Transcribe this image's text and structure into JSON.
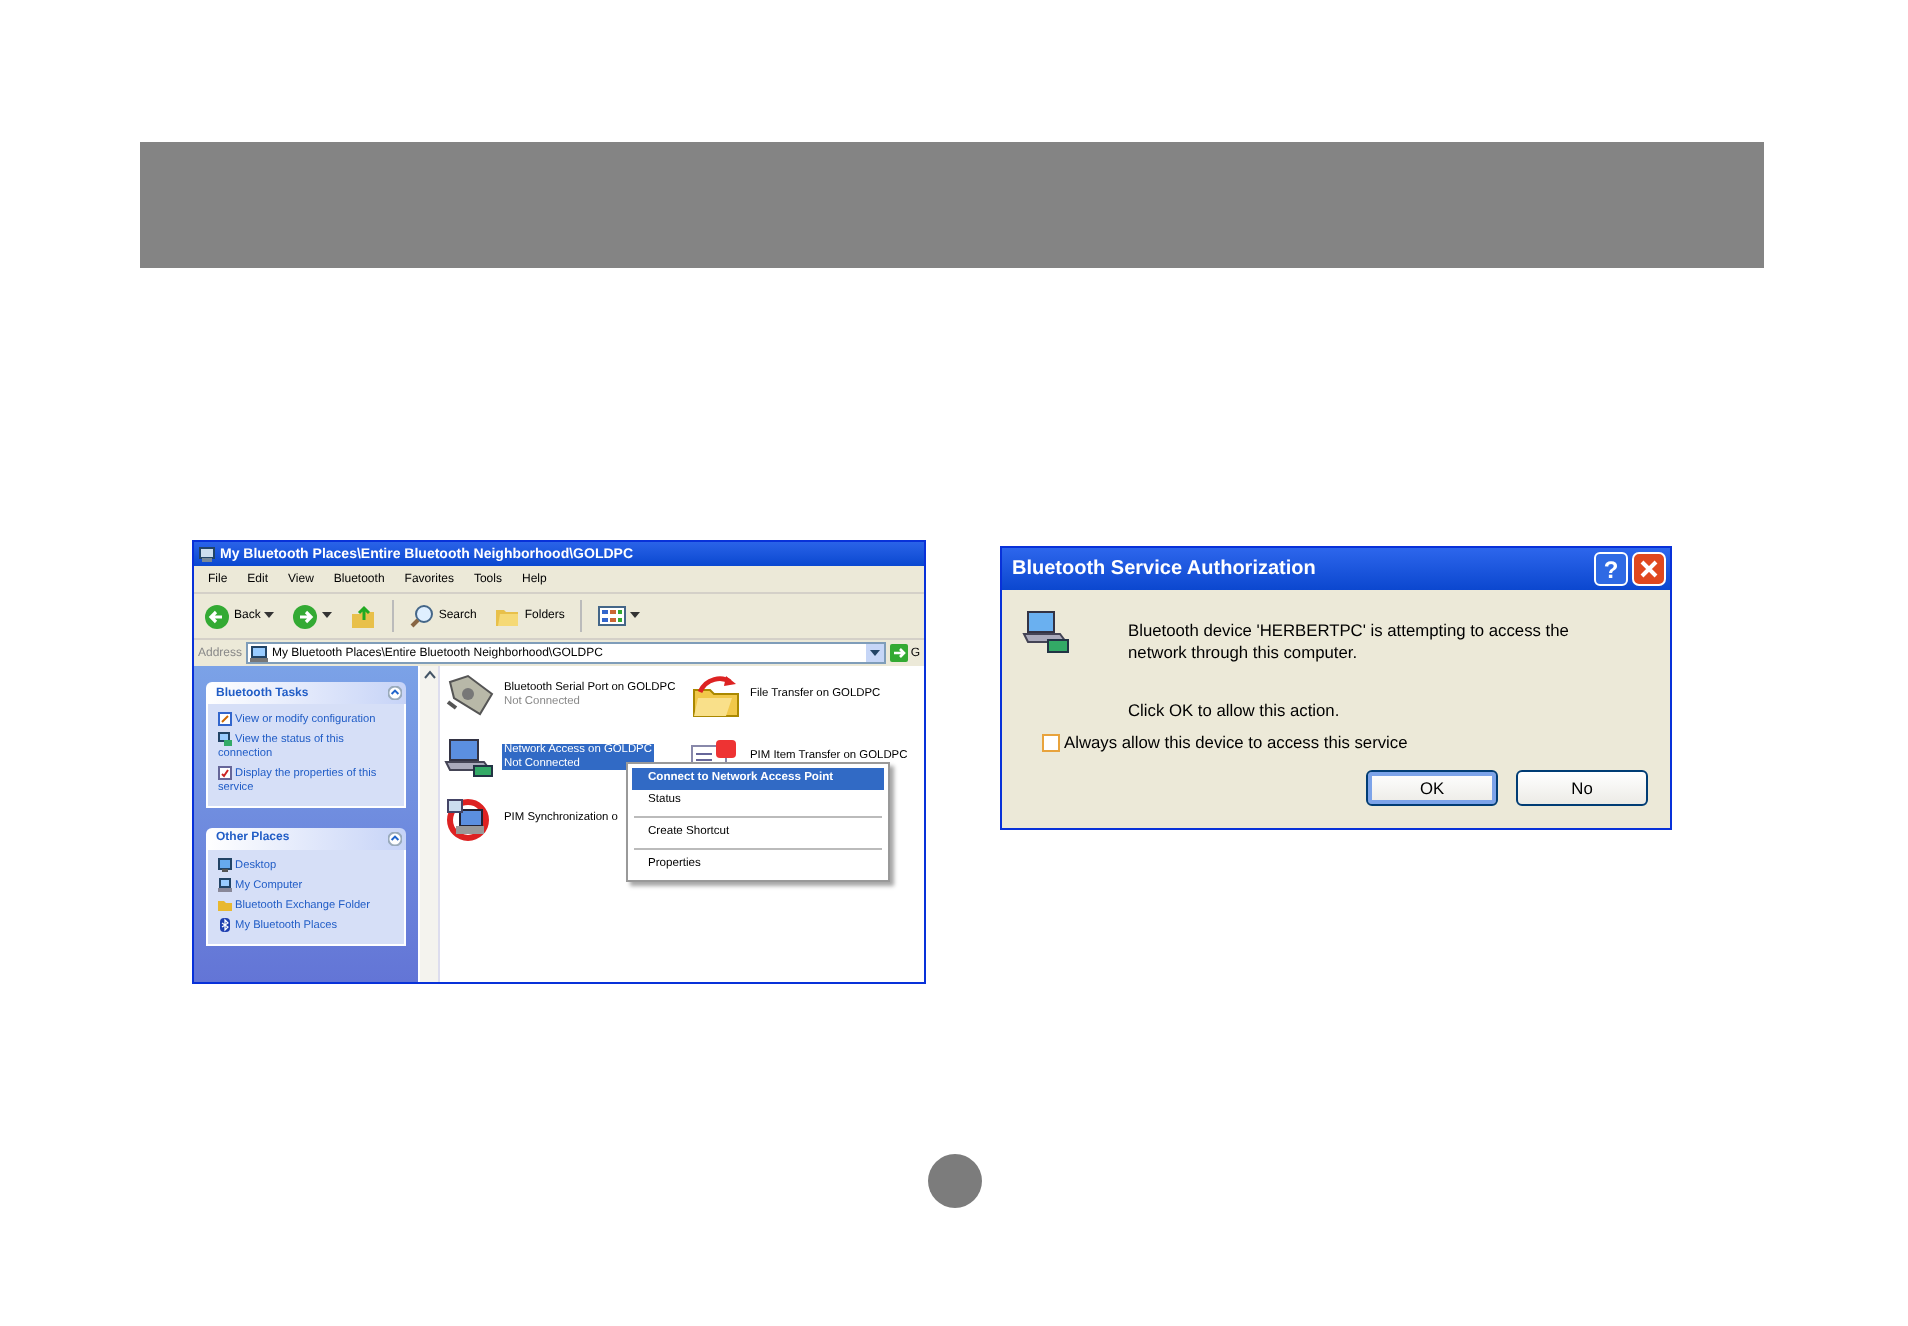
{
  "explorer": {
    "title": "My Bluetooth Places\\Entire Bluetooth Neighborhood\\GOLDPC",
    "menu": [
      "File",
      "Edit",
      "View",
      "Bluetooth",
      "Favorites",
      "Tools",
      "Help"
    ],
    "toolbar": {
      "back": "Back",
      "search": "Search",
      "folders": "Folders"
    },
    "address": {
      "label": "Address",
      "value": "My Bluetooth Places\\Entire Bluetooth Neighborhood\\GOLDPC",
      "go": "G"
    },
    "task_groups": [
      {
        "title": "Bluetooth Tasks",
        "expanded": true,
        "items": [
          "View or modify configuration",
          "View the status of this connection",
          "Display the properties of this service"
        ]
      },
      {
        "title": "Other Places",
        "expanded": true,
        "items": [
          "Desktop",
          "My Computer",
          "Bluetooth Exchange Folder",
          "My Bluetooth Places"
        ]
      }
    ],
    "files": [
      {
        "name": "Bluetooth Serial Port on GOLDPC",
        "status": "Not Connected",
        "selected": false
      },
      {
        "name": "File Transfer on GOLDPC",
        "selected": false
      },
      {
        "name": "Network Access on GOLDPC",
        "status": "Not Connected",
        "selected": true
      },
      {
        "name": "PIM Item Transfer on GOLDPC",
        "selected": false
      },
      {
        "name": "PIM Synchronization o",
        "selected": false
      }
    ],
    "context_menu": {
      "groups": [
        [
          {
            "label": "Connect to Network Access Point",
            "selected": true
          },
          {
            "label": "Status",
            "selected": false
          }
        ],
        [
          {
            "label": "Create Shortcut",
            "selected": false
          }
        ],
        [
          {
            "label": "Properties",
            "selected": false
          }
        ]
      ]
    }
  },
  "dialog": {
    "title": "Bluetooth Service Authorization",
    "help": "?",
    "message": "Bluetooth device 'HERBERTPC' is attempting to access the network through this computer.",
    "hint": "Click OK to allow this action.",
    "checkbox": {
      "label": "Always allow this device to access this service",
      "checked": false
    },
    "buttons": [
      {
        "label": "OK",
        "default": true
      },
      {
        "label": "No",
        "default": false
      }
    ]
  }
}
